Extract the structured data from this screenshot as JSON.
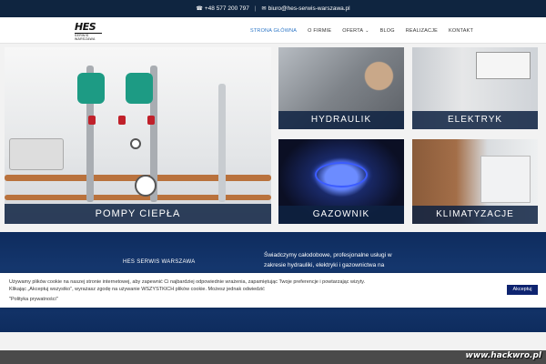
{
  "topbar": {
    "phone": "+48 577 200 797",
    "separator": "|",
    "email": "biuro@hes-serwis-warszawa.pl"
  },
  "logo": {
    "big": "HES",
    "small": "SERWIS WARSZAWA"
  },
  "menu": [
    {
      "label": "Strona główna",
      "active": true
    },
    {
      "label": "O firmie"
    },
    {
      "label": "Oferta",
      "has_caret": true
    },
    {
      "label": "Blog"
    },
    {
      "label": "Realizacje"
    },
    {
      "label": "Kontakt"
    }
  ],
  "tiles": {
    "main": "POMPY CIEPŁA",
    "hydraulik": "HYDRAULIK",
    "elektryk": "ELEKTRYK",
    "gazownik": "GAZOWNIK",
    "klimatyzacje": "KLIMATYZACJE"
  },
  "band": {
    "company": "HES SERWIS WARSZAWA",
    "description": "Świadczymy całodobowe, profesjonalne usługi w zakresie hydrauliki, elektryki i gazownictwa na"
  },
  "cookie": {
    "text": "Używamy plików cookie na naszej stronie internetowej, aby zapewnić Ci najbardziej odpowiednie wrażenia, zapamiętując Twoje preferencje i powtarzając wizyty. Klikając „Akceptuj wszystko”, wyrażasz zgodę na używanie WSZYSTKICH plików cookie. Możesz jednak odwiedzić",
    "policy": "\"Polityka prywatności\"",
    "accept": "Akceptuj"
  },
  "footer": {
    "watermark": "www.hackwro.pl"
  },
  "icons": {
    "phone": "phone-icon",
    "email": "envelope-icon",
    "caret": "chevron-down-icon"
  },
  "colors": {
    "navy": "#0f2540",
    "active_link": "#2e77c7",
    "accept_button": "#0e2470"
  }
}
